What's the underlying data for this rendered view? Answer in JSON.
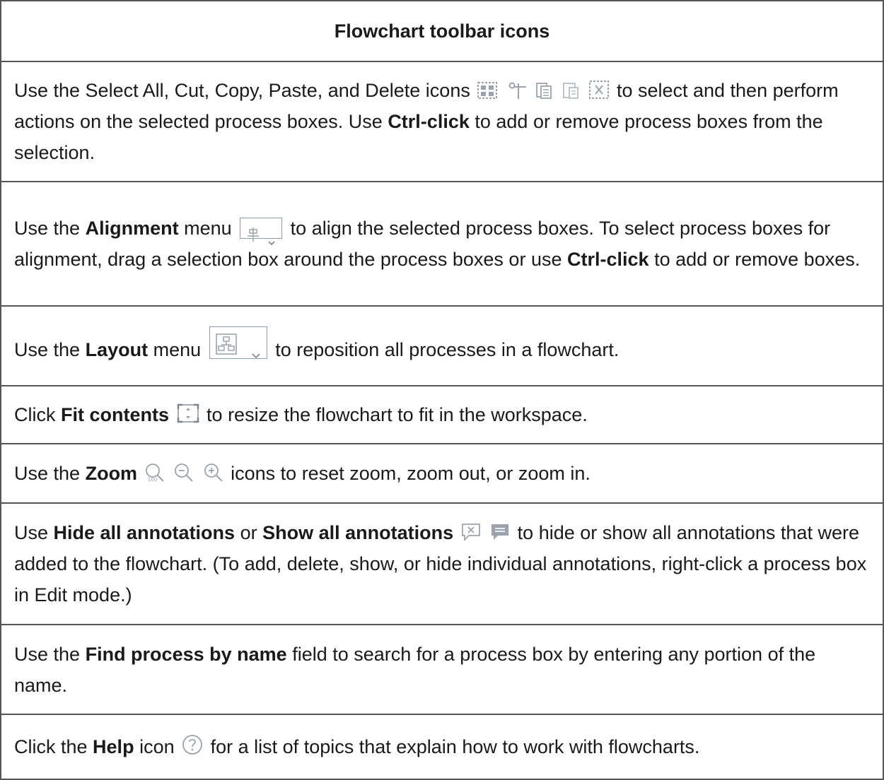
{
  "title": "Flowchart toolbar icons",
  "rows": [
    {
      "t1": "Use the Select All, Cut, Copy, Paste, and Delete icons",
      "t2": "to select and then perform actions on the selected process boxes. Use",
      "b1": "Ctrl-click",
      "t3": "to add or remove process boxes from the selection.",
      "icons": [
        "select-all-icon",
        "cut-icon",
        "copy-icon",
        "paste-icon",
        "delete-icon"
      ]
    },
    {
      "t1": "Use the",
      "b1": "Alignment",
      "t2": "menu",
      "t3": "to align the selected process boxes. To select process box­es for alignment, drag a selection box around the process boxes or use",
      "b2": "Ctrl-click",
      "t4": "to add or remove boxes.",
      "icons": [
        "alignment-icon",
        "chevron-down-icon"
      ]
    },
    {
      "t1": "Use the",
      "b1": "Layout",
      "t2": "menu",
      "t3": "to reposition all processes in a flowchart.",
      "icons": [
        "layout-icon",
        "chevron-down-icon"
      ]
    },
    {
      "t1": "Click",
      "b1": "Fit contents",
      "t2": "to resize the flowchart to fit in the workspace.",
      "icons": [
        "fit-contents-icon"
      ]
    },
    {
      "t1": "Use the",
      "b1": "Zoom",
      "t2": "icons to reset zoom, zoom out, or zoom in.",
      "icons": [
        "zoom-reset-icon",
        "zoom-out-icon",
        "zoom-in-icon"
      ]
    },
    {
      "t1": "Use",
      "b1": "Hide all annotations",
      "t2": "or",
      "b2": "Show all annotations",
      "t3": "to hide or show all annotations that were added to the flowchart. (To add, delete, show, or hide individual annotations, right-click a process box in Edit mode.)",
      "icons": [
        "hide-annotations-icon",
        "show-annotations-icon"
      ]
    },
    {
      "t1": "Use the",
      "b1": "Find process by name",
      "t2": "field to search for a process box by entering any portion of the name."
    },
    {
      "t1": "Click the",
      "b1": "Help",
      "t2": "icon",
      "t3": "for a list of topics that explain how to work with flowcharts.",
      "icons": [
        "help-icon"
      ]
    }
  ],
  "colors": {
    "text": "#1a1a1a",
    "border": "#555555",
    "icon": "#9aa3ad"
  }
}
